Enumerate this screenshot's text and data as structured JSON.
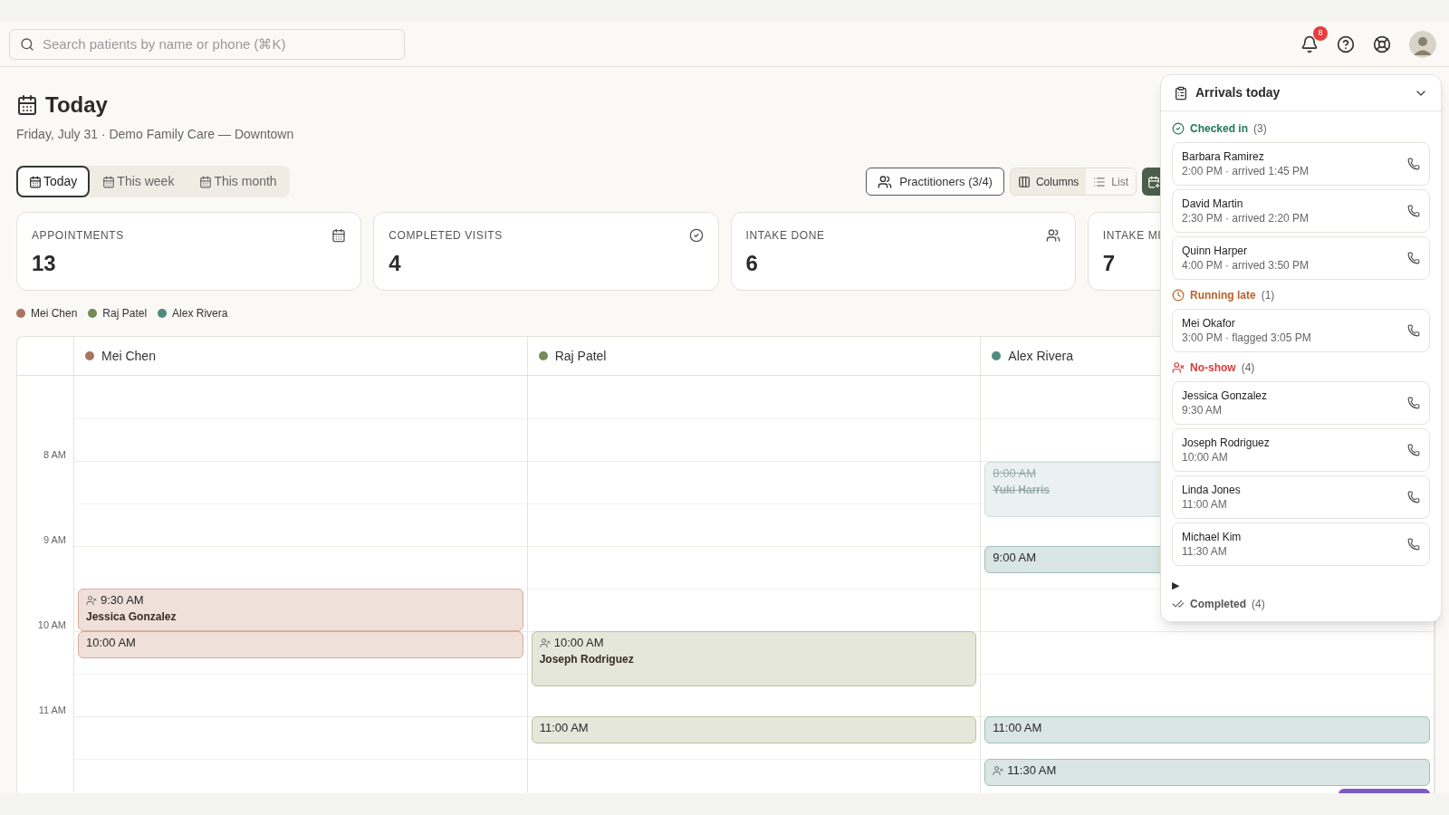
{
  "search": {
    "placeholder": "Search patients by name or phone (⌘K)"
  },
  "notifications": {
    "count": "8"
  },
  "page": {
    "title": "Today",
    "subtitle": "Friday, July 31 · Demo Family Care — Downtown"
  },
  "range_tabs": [
    {
      "label": "Today",
      "selected": true
    },
    {
      "label": "This week",
      "selected": false
    },
    {
      "label": "This month",
      "selected": false
    }
  ],
  "practitioners_button": {
    "label": "Practitioners (3/4)"
  },
  "view_toggle": [
    {
      "label": "Columns",
      "kind": "columns",
      "selected": true
    },
    {
      "label": "List",
      "kind": "list",
      "selected": false
    }
  ],
  "stats": [
    {
      "label": "APPOINTMENTS",
      "value": "13",
      "kind": "calendar"
    },
    {
      "label": "COMPLETED VISITS",
      "value": "4",
      "kind": "check"
    },
    {
      "label": "INTAKE DONE",
      "value": "6",
      "kind": "users"
    },
    {
      "label": "INTAKE MI",
      "value": "7",
      "kind": "none"
    }
  ],
  "legend": [
    {
      "name": "Mei Chen",
      "color": "#a87563"
    },
    {
      "name": "Raj Patel",
      "color": "#75895a"
    },
    {
      "name": "Alex Rivera",
      "color": "#4f8a80"
    }
  ],
  "calendar": {
    "hours": [
      "8 AM",
      "9 AM",
      "10 AM",
      "11 AM"
    ],
    "columns": [
      {
        "name": "Mei Chen",
        "color": "#a87563",
        "events": [
          {
            "time": "9:30 AM",
            "patient": "Jessica Gonzalez",
            "kind": "no_show"
          },
          {
            "time": "10:00 AM",
            "kind": "booked"
          }
        ]
      },
      {
        "name": "Raj Patel",
        "color": "#75895a",
        "events": [
          {
            "time": "10:00 AM",
            "patient": "Joseph Rodriguez",
            "kind": "no_show"
          },
          {
            "time": "11:00 AM",
            "kind": "booked"
          }
        ]
      },
      {
        "name": "Alex Rivera",
        "color": "#4f8a80",
        "events": [
          {
            "time": "8:00 AM",
            "patient": "Yuki Harris",
            "kind": "cancelled"
          },
          {
            "time": "9:00 AM",
            "kind": "booked"
          },
          {
            "time": "11:00 AM",
            "kind": "booked"
          },
          {
            "time": "11:30 AM",
            "kind": "no_show"
          },
          {
            "kind": "other"
          }
        ]
      }
    ]
  },
  "arrivals": {
    "title": "Arrivals today",
    "groups": [
      {
        "kind": "checked_in",
        "label": "Checked in",
        "count": "(3)",
        "patients": [
          {
            "name": "Barbara Ramirez",
            "detail": "2:00 PM · arrived 1:45 PM"
          },
          {
            "name": "David Martin",
            "detail": "2:30 PM · arrived 2:20 PM"
          },
          {
            "name": "Quinn Harper",
            "detail": "4:00 PM · arrived 3:50 PM"
          }
        ]
      },
      {
        "kind": "late",
        "label": "Running late",
        "count": "(1)",
        "patients": [
          {
            "name": "Mei Okafor",
            "detail": "3:00 PM · flagged 3:05 PM"
          }
        ]
      },
      {
        "kind": "no_show",
        "label": "No-show",
        "count": "(4)",
        "patients": [
          {
            "name": "Jessica Gonzalez",
            "detail": "9:30 AM"
          },
          {
            "name": "Joseph Rodriguez",
            "detail": "10:00 AM"
          },
          {
            "name": "Linda Jones",
            "detail": "11:00 AM"
          },
          {
            "name": "Michael Kim",
            "detail": "11:30 AM"
          }
        ]
      }
    ],
    "completed": {
      "marker": "▶",
      "label": "Completed",
      "count": "(4)"
    }
  }
}
